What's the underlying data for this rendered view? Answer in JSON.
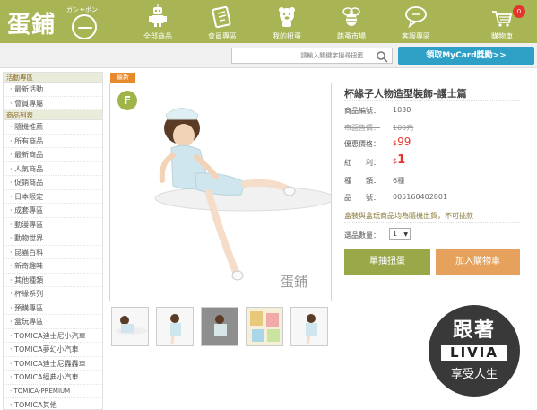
{
  "header": {
    "logo_text": "蛋鋪",
    "logo_kana": "ガシャポン",
    "nav": [
      {
        "label": "全部商品",
        "icon": "robot-icon"
      },
      {
        "label": "會員專區",
        "icon": "member-card-icon"
      },
      {
        "label": "我的扭蛋",
        "icon": "bear-icon"
      },
      {
        "label": "跳蚤市場",
        "icon": "bee-icon"
      },
      {
        "label": "客服專區",
        "icon": "chat-bubble-icon"
      },
      {
        "label": "購物車",
        "icon": "cart-icon",
        "badge": "0"
      }
    ]
  },
  "search": {
    "placeholder": "請輸入關鍵字搜尋扭蛋...",
    "mycard_label": "領取MyCard獎勵>>"
  },
  "sidebar": {
    "sections": [
      {
        "heading": "活動專區",
        "items": [
          "最新活動",
          "會員專屬"
        ]
      },
      {
        "heading": "商品列表",
        "items": [
          "隨機推薦",
          "所有商品",
          "最新商品",
          "人氣商品",
          "促銷商品",
          "日本限定",
          "成套專區",
          "動漫專區",
          "動物世界",
          "昆蟲百科",
          "新奇趣味",
          "其他種類",
          "杯緣系列",
          "預購專區",
          "盒玩專區",
          "TOMICA迪士尼小汽車",
          "TOMICA夢幻小汽車",
          "TOMICA迪士尼轟轟車",
          "TOMICA經典小汽車",
          "TOMICA-PREMIUM",
          "TOMICA其他"
        ]
      }
    ]
  },
  "product": {
    "tag": "最新",
    "badge_letter": "F",
    "image_sign": "蛋鋪",
    "title": "杯緣子人物造型裝飾-護士篇",
    "rows": {
      "code_label": "商品編號：",
      "code_value": "1030",
      "orig_label": "市面售價：",
      "orig_value": "100元",
      "price_label": "優惠價格：",
      "price_prefix": "$",
      "price_value": "99",
      "bonus_label": "紅　　利：",
      "bonus_prefix": "$",
      "bonus_value": "1",
      "kinds_label": "種　　類：",
      "kinds_value": "6種",
      "sku_label": "品　　號：",
      "sku_value": "005160402801"
    },
    "notice": "盒裝與盒玩商品均為隨機出貨，不可挑款",
    "qty_label": "選品數量：",
    "qty_value": "1",
    "btn_gacha": "單抽扭蛋",
    "btn_cart": "加入購物車"
  },
  "watermark": {
    "top": "跟著",
    "mid": "LIVIA",
    "bottom": "享受人生"
  },
  "colors": {
    "header_green": "#a9b455",
    "accent_red": "#e3352c",
    "mycard_blue": "#2ea0c6",
    "gacha_green": "#9aa84a",
    "cart_orange": "#e6a25c"
  }
}
